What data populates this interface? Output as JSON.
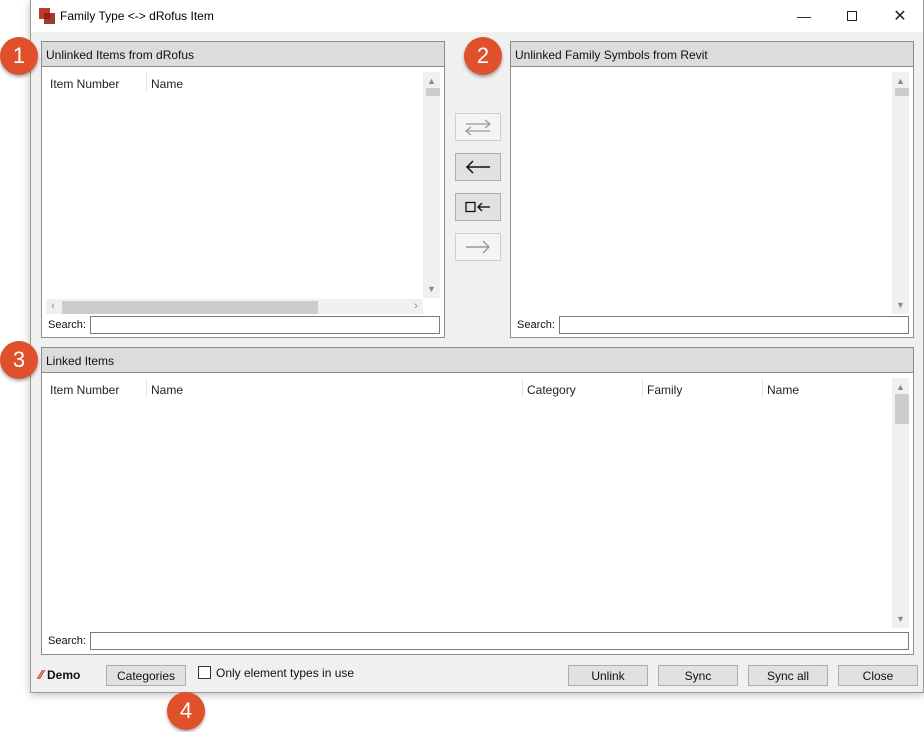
{
  "window": {
    "title": "Family Type <-> dRofus Item",
    "minimize_glyph": "—",
    "close_glyph": "✕"
  },
  "badges": [
    "1",
    "2",
    "3",
    "4"
  ],
  "unlinked_dRofus": {
    "header": "Unlinked Items from dRofus",
    "columns": [
      "Item Number",
      "Name"
    ],
    "search_label": "Search:",
    "search_value": ""
  },
  "unlinked_revit": {
    "header": "Unlinked Family Symbols from Revit",
    "search_label": "Search:",
    "search_value": ""
  },
  "middle_buttons": [
    {
      "icon": "swap-arrows-icon",
      "enabled": false
    },
    {
      "icon": "arrow-left-icon",
      "enabled": true
    },
    {
      "icon": "box-arrow-left-icon",
      "enabled": true
    },
    {
      "icon": "arrow-right-icon",
      "enabled": false
    }
  ],
  "linked": {
    "header": "Linked Items",
    "columns": [
      "Item Number",
      "Name",
      "Category",
      "Family",
      "Name"
    ],
    "search_label": "Search:",
    "search_value": ""
  },
  "footer": {
    "logo_text": "Demo",
    "categories_label": "Categories",
    "only_in_use_label": "Only element types in use",
    "only_in_use_checked": false,
    "unlink_label": "Unlink",
    "sync_label": "Sync",
    "sync_all_label": "Sync all",
    "close_label": "Close"
  },
  "colors": {
    "badge": "#e0502b",
    "header_bg": "#dcdcdc",
    "window_bg": "#f0f0f0"
  }
}
